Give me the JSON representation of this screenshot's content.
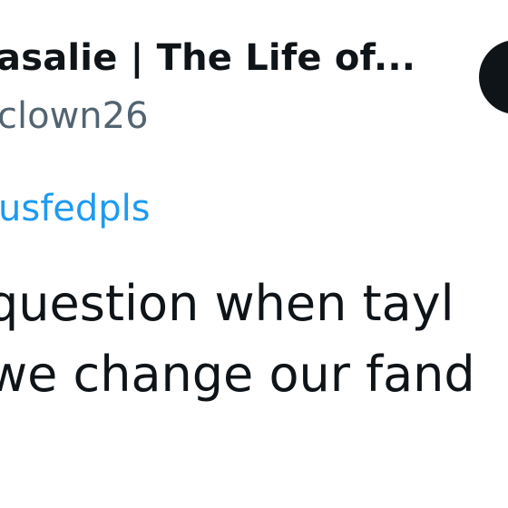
{
  "tweet": {
    "author": {
      "display_name": "asalie | The Life of...",
      "handle": "clown26"
    },
    "reply_to": "usfedpls",
    "text_lines": [
      "question when tayl",
      "we change our fand"
    ]
  },
  "colors": {
    "text_primary": "#0f1419",
    "text_secondary": "#536471",
    "link": "#1d9bf0",
    "button_bg": "#0f1419",
    "background": "#ffffff"
  }
}
